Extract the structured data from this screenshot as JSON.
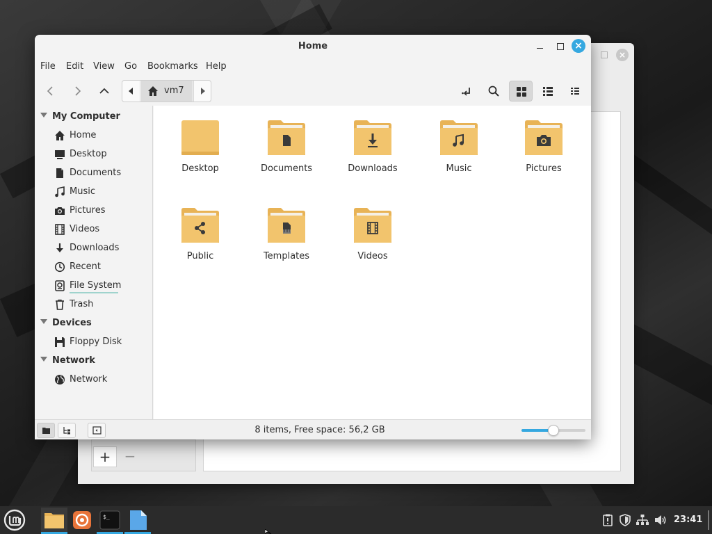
{
  "window": {
    "title": "Home"
  },
  "menubar": [
    "File",
    "Edit",
    "View",
    "Go",
    "Bookmarks",
    "Help"
  ],
  "pathbar": {
    "current": "vm7"
  },
  "sidebar": {
    "sections": [
      {
        "heading": "My Computer",
        "items": [
          {
            "label": "Home",
            "icon": "home-icon"
          },
          {
            "label": "Desktop",
            "icon": "desktop-icon"
          },
          {
            "label": "Documents",
            "icon": "document-icon"
          },
          {
            "label": "Music",
            "icon": "music-icon"
          },
          {
            "label": "Pictures",
            "icon": "camera-icon"
          },
          {
            "label": "Videos",
            "icon": "film-icon"
          },
          {
            "label": "Downloads",
            "icon": "download-icon"
          },
          {
            "label": "Recent",
            "icon": "clock-icon"
          },
          {
            "label": "File System",
            "icon": "drive-icon"
          },
          {
            "label": "Trash",
            "icon": "trash-icon"
          }
        ]
      },
      {
        "heading": "Devices",
        "items": [
          {
            "label": "Floppy Disk",
            "icon": "floppy-icon"
          }
        ]
      },
      {
        "heading": "Network",
        "items": [
          {
            "label": "Network",
            "icon": "globe-icon"
          }
        ]
      }
    ]
  },
  "files": [
    {
      "name": "Desktop",
      "icon": "folder-icon"
    },
    {
      "name": "Documents",
      "icon": "folder-documents-icon"
    },
    {
      "name": "Downloads",
      "icon": "folder-downloads-icon"
    },
    {
      "name": "Music",
      "icon": "folder-music-icon"
    },
    {
      "name": "Pictures",
      "icon": "folder-pictures-icon"
    },
    {
      "name": "Public",
      "icon": "folder-public-icon"
    },
    {
      "name": "Templates",
      "icon": "folder-templates-icon"
    },
    {
      "name": "Videos",
      "icon": "folder-videos-icon"
    }
  ],
  "statusbar": {
    "text": "8 items, Free space: 56,2 GB",
    "zoom_level": 0.5
  },
  "back_window": {
    "add_label": "+",
    "remove_label": "−"
  },
  "taskbar": {
    "clock": "23:41"
  },
  "colors": {
    "accent": "#35a8e0",
    "folder": "#f2c46d",
    "folder_tab": "#e8b356"
  }
}
